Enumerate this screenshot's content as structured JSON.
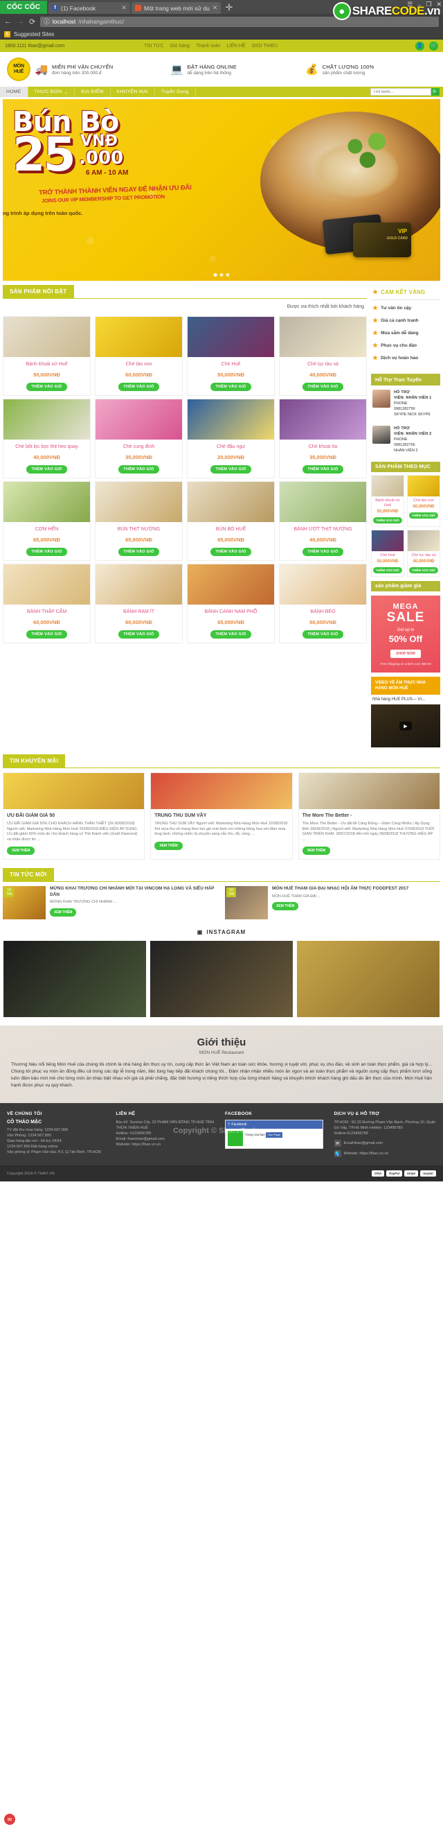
{
  "browser": {
    "logo": "CỐC CỐC",
    "tabs": [
      {
        "title": "(1) Facebook",
        "favicon": "facebook-icon"
      },
      {
        "title": "Một trang web mới sử dụ",
        "favicon": "orange-icon"
      }
    ],
    "url_domain": "localhost",
    "url_path": "/nhahangamthuc/",
    "bookmark": "Suggested Sites",
    "watermark": "SHARECODE.vn"
  },
  "topbar": {
    "phone": "1800.1111",
    "email": "thao@gmail.com",
    "nav": [
      "TIN TỨC",
      "Giỏ hàng",
      "Thanh toán",
      "LIÊN HỆ",
      "GIOI THIEU"
    ],
    "user_icon": "user-icon",
    "cart_icon": "cart-icon"
  },
  "brand": {
    "line1": "MÓN",
    "line2": "HUẾ"
  },
  "features": [
    {
      "icon": "truck-icon",
      "title": "MIỄN PHÍ VẬN CHUYỂN",
      "sub": "đơn hàng trên 200.000.đ"
    },
    {
      "icon": "laptop-person-icon",
      "title": "ĐẶT HÀNG ONLINE",
      "sub": "dễ dàng trên hệ thống"
    },
    {
      "icon": "dollar-coin-icon",
      "title": "CHẤT LƯỢNG 100%",
      "sub": "sản phẩm chất lượng"
    }
  ],
  "mainnav": {
    "items": [
      "HOME",
      "THỰC ĐƠN",
      "ĐỊA ĐIỂM",
      "KHUYẾN MAI",
      "Tuyển Dụng"
    ],
    "search_placeholder": "Tìm kiếm...",
    "search_value": ""
  },
  "hero": {
    "title": "Bún Bò",
    "price": "25",
    "currency": "VNĐ",
    "price_decimals": ".000",
    "time": "6 AM - 10 AM",
    "line1": "TRỞ THÀNH THÀNH VIÊN NGAY ĐỂ NHẬN ƯU ĐÃI",
    "line2": "JOINS OUR VIP MEMBERSHIP TO GET PROMOTION",
    "line3": "ng trình áp dụng trên toàn quốc.",
    "card_vip": "VIP",
    "card_gold": "GOLD CARD"
  },
  "featured": {
    "title": "SẢN PHẨM NỔI BẬT",
    "subtitle": "Được ưa thích nhất bởi khách hàng",
    "add_label": "THÊM VÀO GIỎ",
    "rows": [
      [
        {
          "name": "Bánh khoái xứ Huế",
          "price": "50,000VNĐ",
          "img": "banhkhoai"
        },
        {
          "name": "Chè táo xon",
          "price": "60,000VNĐ",
          "img": "chetao"
        },
        {
          "name": "Chè Huế",
          "price": "50,000VNĐ",
          "img": "chehue"
        },
        {
          "name": "Chè lục tàu xá",
          "price": "40,000VNĐ",
          "img": "cheluc"
        }
      ],
      [
        {
          "name": "Chè bột lọc bọc thịt heo quay",
          "price": "40,000VNĐ",
          "img": "chebotloc"
        },
        {
          "name": "Chè cung đình",
          "price": "35,000VNĐ",
          "img": "checung"
        },
        {
          "name": "Chè đậu ngự",
          "price": "20,000VNĐ",
          "img": "chedau"
        },
        {
          "name": "Chè khoai tía",
          "price": "35,000VNĐ",
          "img": "chekhoai"
        }
      ],
      [
        {
          "name": "CƠM HẾN",
          "price": "65,000VNĐ",
          "img": "comhen"
        },
        {
          "name": "BÚN THỊT NƯỚNG",
          "price": "65,000VNĐ",
          "img": "bunthit"
        },
        {
          "name": "BÚN BÒ HUẾ",
          "price": "65,000VNĐ",
          "img": "bunbo"
        },
        {
          "name": "BÁNH ƯỚT THỊT NƯỚNG",
          "price": "40,000VNĐ",
          "img": "banhuot"
        }
      ],
      [
        {
          "name": "BÁNH THẬP CẨM",
          "price": "60,000VNĐ",
          "img": "banhthap"
        },
        {
          "name": "BÁNH RAM ÍT",
          "price": "60,000VNĐ",
          "img": "banhram"
        },
        {
          "name": "BÁNH CANH NAM PHỔ",
          "price": "65,000VNĐ",
          "img": "banhcanh"
        },
        {
          "name": "BÁNH BÈO",
          "price": "50,000VNĐ",
          "img": "banhbeo"
        }
      ]
    ]
  },
  "sidebar": {
    "commit_title": "CAM KẾT VÀNG",
    "commit_icon": "star-icon",
    "commitments": [
      "Tư vấn tin cậy",
      "Giá cả cạnh tranh",
      "Mua sắm dễ dàng",
      "Phục vụ chu đáo",
      "Dịch vụ hoàn hảo"
    ],
    "support_title": "Hỗ Trợ Trực Tuyến",
    "supports": [
      {
        "role": "HỖ TRỢ",
        "name": "VIÊN: NHÂN VIÊN 1",
        "phone_label": "PHONE",
        "phone": "0981282756",
        "extra": "SKYPE NICK SKYPE"
      },
      {
        "role": "HỖ TRỢ",
        "name": "VIÊN: NHÂN VIÊN 2",
        "phone_label": "PHONE",
        "phone": "0981282756",
        "extra": "NHÂN VIÊN 2"
      }
    ],
    "cat_title": "SẢN PHẨM THEO MỤC",
    "cat_products": [
      {
        "name": "Bánh khoái xứ Huế",
        "price": "50,000VNĐ"
      },
      {
        "name": "Chè táo xon",
        "price": "60,000VNĐ"
      },
      {
        "name": "Chè Huế",
        "price": "50,000VNĐ"
      },
      {
        "name": "Chè lục tàu xá",
        "price": "40,000VNĐ"
      }
    ],
    "cat_add_label": "THÊM VÀO GIỎ",
    "sale_head": "sản phẩm giảm giá",
    "sale": {
      "mega": "MEGA",
      "sale": "SALE",
      "getup": "Get up to",
      "off": "50% Off",
      "shop": "SHOP NOW",
      "note": "Free Shipping on orders over $99.00"
    },
    "video_head": "VIDEO VỀ ẨM THỰC NHÀ HÀNG MÓN HUẾ",
    "video_title": "Nhà hàng HUE PLUS--- VI..."
  },
  "promo": {
    "title": "TIN KHUYẾN MÃI",
    "btn": "XEM THÊM",
    "items": [
      {
        "head": "ƯU ĐÃI GIẢM GIÁ 50",
        "desc": "ƯU ĐÃI GIẢM GIÁ 50% CHO KHÁCH HÀNG THÂN THIẾT (26-30/08/2018) Người viết: Marketing Nhà Hàng Món Huế  25/08/2018 ĐIỀU KIỆN ÁP DỤNG: Ưu đãi giảm 50% món ăn cho khách hàng có Thẻ thành viên (Gold Diamond) và nhận được tin ..."
      },
      {
        "head": "TRUNG THU SUM VẦY",
        "desc": "TRUNG THU SUM VẦY Người viết: Marketing Nhà Hàng Món Huế  22/08/2018 Khi mùa thu về mang theo lan gió mát lành với những bông hoa với đầm mùa lòng lanh, những chiếc lá chuyển sang sắc tím, đỏ, vàng ..."
      },
      {
        "head": "The More The Better -",
        "desc": "The More The Better - Ưu đãi Đi Cáng Đông – Giảm Càng Nhiều | Áp Dụng Đến 28/08/2018 | Người viết: Marketing Nhà Hàng Món Huế  07/08/2018 THỜI GIAN TRIỂN KHAI: 28/07/2018 đến hết ngày 28/08/2018 THƯƠNG HIỆU ÁP ..."
      }
    ]
  },
  "news": {
    "title": "TIN TỨC MỚI",
    "btn": "XEM THÊM",
    "items": [
      {
        "day": "18",
        "month": "Th8",
        "head": "MỪNG KHAI TRƯƠNG CHI NHÁNH MỚI TẠI VINCOM HẠ LONG VÀ SIÊU HẤP DẪN",
        "desc": "MỪNG KHAI TRƯƠNG CHI NHÁNH ..."
      },
      {
        "day": "18",
        "month": "Th8",
        "head": "MÓN HUẾ THAM GIA ĐẠI NHẠC HỘI ẨM THỰC FOODFEST 2017",
        "desc": "MÓN HUẾ THAM GIA ĐẠI ..."
      }
    ]
  },
  "instagram": {
    "title": "INSTAGRAM",
    "icon": "instagram-icon"
  },
  "about": {
    "title": "Giới thiệu",
    "subtitle": "MÓN HUẾ Restaurant",
    "paragraphs": [
      "Thương hiệu nổi tiếng Món Huế của chúng tôi chính là nhà hàng ẩm thực uy tín, cung cấp thức ăn Việt Nam an toàn sức khỏe, hương vị tuyệt vời, phục vụ chu đáo, vệ sinh an toàn thực phẩm, giá cả hợp lý... Chúng tôi phục vụ món ăn đồng đều cả trong các dịp lễ trong năm, tiệc tùng hay tiếp đãi khách chúng tôi... Đảm nhận nhận nhiều món ăn ngon và an toàn thực phẩm và nguồn cung cấp thực phẩm tươi sống luôn đảm bảo mới mẻ cho từng món ăn khác biệt nhau với giá cả phải chăng, đặc biệt hương vị riêng thích hợp của từng khách hàng và khuyến khích khách hàng ghi dấu ấn ẩm thực của mình. Món Huế hân hạnh được phục vụ quý khách."
    ]
  },
  "footer": {
    "col1": {
      "head": "VỀ CHÚNG TÔI",
      "company": "CÔ THẢO MẶC",
      "lines": [
        "TV đặt thu mua hàng: 1234.567.890",
        "Văn Phòng: 1234.567.890",
        "Giao hàng tận nơi - hổ trợ 24/24",
        "1234.567.890 Đặt hàng online",
        "Văn phòng sỉ: Phạm Văn Hai, P.3, Q.Tân Bình, TP.HCM"
      ]
    },
    "col2": {
      "head": "LIÊN HỆ",
      "lines": [
        "Địa chỉ: Sunrise City, 22 PHẠM VĂN ĐỒNG TP.HUẾ TỈNH THỪA THIÊN HUẾ",
        "Hotline: 0123456789",
        "Email: thaonhan@gmail.com",
        "Website: https://thao.vn.vn"
      ]
    },
    "col3": {
      "head": "FACEBOOK",
      "fb_name": "Facebook",
      "fb_sub": "Trang của bạn",
      "fb_like": "Like Page"
    },
    "col4": {
      "head": "DỊCH VỤ & HỖ TRỢ",
      "lines": [
        "TP.HCM : Số 22 Đường Phạm Văn Bạch, Phường 10, Quận Gò Vấp, TP.Hồ Minh Hotline: 123456789",
        "Hotline:0123456789"
      ],
      "email_row": "Email:thao@gmail.com",
      "web_row": "Website: https://thao.vn.vn",
      "email_icon": "envelope-icon",
      "web_icon": "globe-icon"
    },
    "watermark": "Copyright © ShareCode.vn",
    "copyright": "Copyright 2018 © THAO.VN",
    "payments": [
      "VISA",
      "PayPal",
      "stripe",
      "master"
    ],
    "chat_icon": "chat-icon"
  }
}
